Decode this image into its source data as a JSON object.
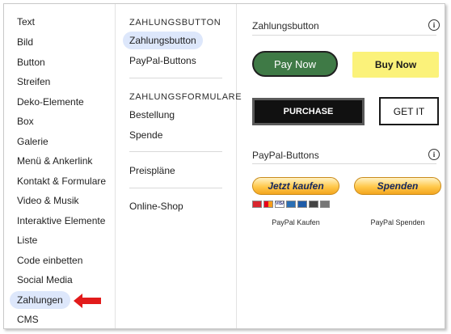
{
  "categories": [
    {
      "label": "Text"
    },
    {
      "label": "Bild"
    },
    {
      "label": "Button"
    },
    {
      "label": "Streifen"
    },
    {
      "label": "Deko-Elemente"
    },
    {
      "label": "Box"
    },
    {
      "label": "Galerie"
    },
    {
      "label": "Menü & Ankerlink"
    },
    {
      "label": "Kontakt & Formulare"
    },
    {
      "label": "Video & Musik"
    },
    {
      "label": "Interaktive Elemente"
    },
    {
      "label": "Liste"
    },
    {
      "label": "Code einbetten"
    },
    {
      "label": "Social Media"
    },
    {
      "label": "Zahlungen",
      "active": true
    },
    {
      "label": "CMS"
    }
  ],
  "subpanel": {
    "zahlungsbutton_heading": "ZAHLUNGSBUTTON",
    "zahlungsbutton_item": "Zahlungsbutton",
    "paypal_item": "PayPal-Buttons",
    "formulare_heading": "ZAHLUNGSFORMULARE",
    "bestellung_item": "Bestellung",
    "spende_item": "Spende",
    "preisplaene_item": "Preispläne",
    "onlineshop_item": "Online-Shop"
  },
  "content": {
    "section1_title": "Zahlungsbutton",
    "info_glyph": "i",
    "pay_now": "Pay Now",
    "buy_now": "Buy Now",
    "purchase": "PURCHASE",
    "get_it": "GET IT",
    "section2_title": "PayPal-Buttons",
    "jetzt_kaufen": "Jetzt kaufen",
    "spenden": "Spenden",
    "card_logos_text": "VISA",
    "caption_kaufen": "PayPal Kaufen",
    "caption_spenden": "PayPal Spenden"
  },
  "colors": {
    "active_bg": "#dde7fb",
    "pay_now_green": "#3f7a46",
    "buy_now_yellow": "#fbf27a",
    "arrow_red": "#e21b1b"
  },
  "icons": [
    "info-icon",
    "red-arrow-icon",
    "credit-card-logos-icon"
  ]
}
